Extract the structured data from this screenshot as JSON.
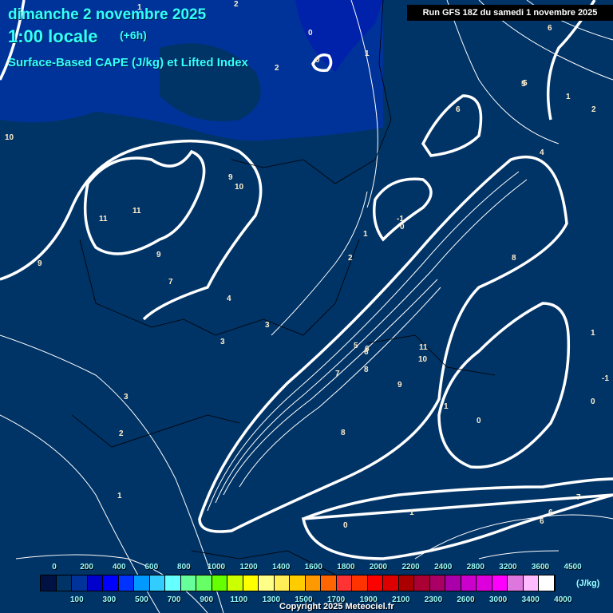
{
  "header": {
    "date": "dimanche 2 novembre 2025",
    "time": "1:00 locale",
    "offset": "(+6h)",
    "parameter": "Surface-Based CAPE (J/kg) et Lifted Index",
    "run": "Run GFS 18Z du samedi 1 novembre 2025"
  },
  "legend": {
    "top_labels": [
      "0",
      "200",
      "400",
      "600",
      "800",
      "1000",
      "1200",
      "1400",
      "1600",
      "1800",
      "2000",
      "2200",
      "2400",
      "2800",
      "3200",
      "3600",
      "4500"
    ],
    "bottom_labels": [
      "100",
      "300",
      "500",
      "700",
      "900",
      "1100",
      "1300",
      "1500",
      "1700",
      "1900",
      "2100",
      "2300",
      "2600",
      "3000",
      "3400",
      "4000"
    ],
    "unit": "(J/kg)",
    "colors": [
      "#001144",
      "#003366",
      "#003399",
      "#0000cc",
      "#0000ff",
      "#0033ff",
      "#0099ff",
      "#33ccff",
      "#66ffff",
      "#66ff99",
      "#66ff66",
      "#66ff00",
      "#ccff00",
      "#ffff00",
      "#ffff88",
      "#ffee55",
      "#ffcc00",
      "#ff9900",
      "#ff6600",
      "#ff3333",
      "#ff3300",
      "#ff0000",
      "#dd0000",
      "#aa0000",
      "#aa0033",
      "#aa0066",
      "#aa00aa",
      "#cc00cc",
      "#dd00dd",
      "#ff00ff",
      "#dd77dd",
      "#ffbbff",
      "#ffffff"
    ]
  },
  "contour_labels": [
    "1",
    "2",
    "0",
    "0",
    "1",
    "2",
    "6",
    "5",
    "6",
    "1",
    "2",
    "10",
    "9",
    "10",
    "11",
    "11",
    "9",
    "7",
    "4",
    "0",
    "-1",
    "1",
    "2",
    "3",
    "6",
    "7",
    "8",
    "3",
    "2",
    "5",
    "6",
    "9",
    "8",
    "11",
    "10",
    "1",
    "0",
    "1",
    "3",
    "9",
    "8",
    "0",
    "1",
    "6",
    "6",
    "5",
    "4",
    "1",
    "7",
    "0",
    "-1"
  ],
  "copyright": "Copyright 2025 Meteociel.fr"
}
